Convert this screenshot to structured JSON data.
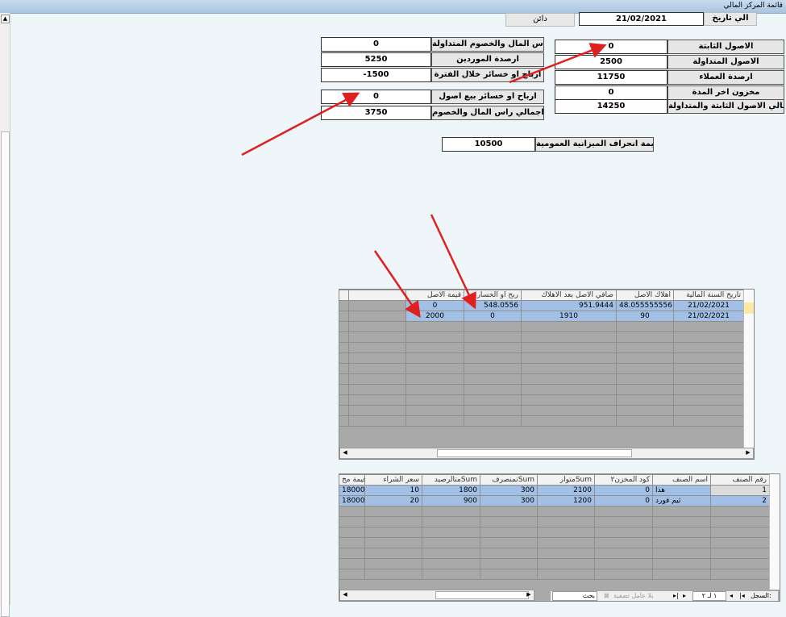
{
  "window": {
    "title": "قائمة المركز المالي"
  },
  "header": {
    "to_date_label": "الي تاريخ",
    "to_date_value": "21/02/2021",
    "side_label": "دائن"
  },
  "left_panel": {
    "rows": [
      {
        "label": "راس المال والخصوم المتداولة",
        "value": "0"
      },
      {
        "label": "ارصدة الموردين",
        "value": "5250"
      },
      {
        "label": "ارباح او خسائر خلال الفترة",
        "value": "-1500"
      }
    ],
    "rows2": [
      {
        "label": "ارباح او خسائر بيع اصول",
        "value": "0"
      },
      {
        "label": "اجمالي راس المال والخصوم",
        "value": "3750"
      }
    ]
  },
  "right_panel": {
    "rows": [
      {
        "label": "الاصول الثابتة",
        "value": "0"
      },
      {
        "label": "الاصول المتداولة",
        "value": "2500"
      },
      {
        "label": "ارصدة العملاء",
        "value": "11750"
      },
      {
        "label": "مخزون اخر المدة",
        "value": "0"
      },
      {
        "label": "اجمالي الاصول الثابتة والمتداولة",
        "value": "14250"
      }
    ]
  },
  "deviation": {
    "label": "قيمة انحراف الميزانية العمومية",
    "value": "10500"
  },
  "assets_grid": {
    "headers": [
      "تاريخ السنة المالية",
      "اهلاك الاصل",
      "صافي الاصل بعد الاهلاك",
      "ربح او الخسارة",
      "قيمة الاصل"
    ],
    "rows": [
      [
        "21/02/2021",
        "48.055555556",
        "951.9444",
        "548.0556",
        "0"
      ],
      [
        "21/02/2021",
        "90",
        "1910",
        "0",
        "2000"
      ]
    ]
  },
  "items_grid": {
    "headers": [
      "رقم الصنف",
      "اسم الصنف",
      "كود المخزن٢",
      "متوارSum",
      "تمنصرفSum",
      "متالرصيدSum",
      "سعر الشراء",
      "قيمة مخ"
    ],
    "rows": [
      [
        "1",
        "هذا",
        "0",
        "2100",
        "300",
        "1800",
        "10",
        "18000"
      ],
      [
        "2",
        "ثيم فورد",
        "0",
        "1200",
        "300",
        "900",
        "20",
        "18000"
      ]
    ],
    "nav": {
      "record_label": "السجل:",
      "record_of": "١ لـ ٢",
      "filter_label": "بلا عامل تصفية",
      "search_label": "بحث"
    }
  }
}
